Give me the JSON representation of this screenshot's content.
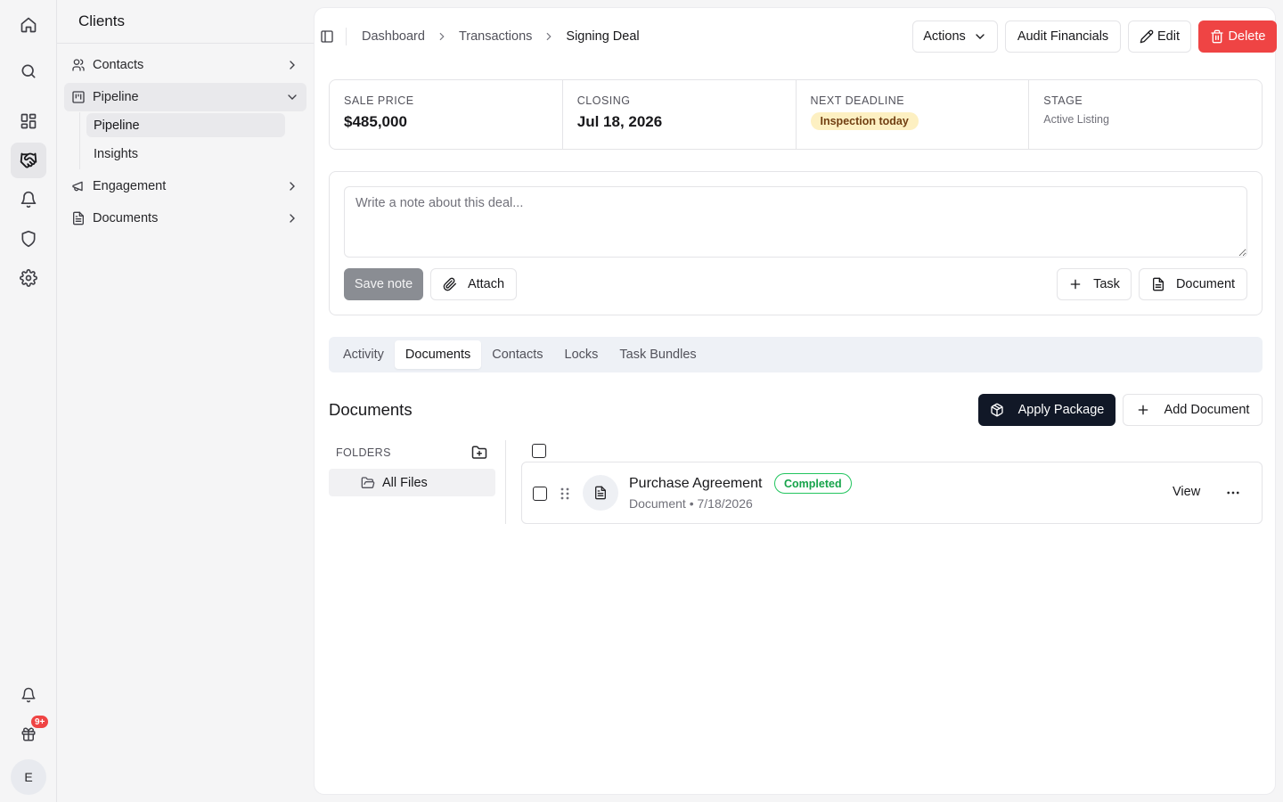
{
  "app": {
    "user_initial": "E",
    "gift_badge": "9+"
  },
  "sidebar": {
    "title": "Clients",
    "items": [
      {
        "label": "Contacts",
        "icon": "users-icon"
      },
      {
        "label": "Pipeline",
        "icon": "kanban-icon"
      },
      {
        "label": "Engagement",
        "icon": "megaphone-icon"
      },
      {
        "label": "Documents",
        "icon": "file-text-icon"
      }
    ],
    "pipeline_sub": [
      "Pipeline",
      "Insights"
    ]
  },
  "breadcrumb": [
    "Dashboard",
    "Transactions",
    "Signing Deal"
  ],
  "toolbar": {
    "actions_label": "Actions",
    "audit_label": "Audit Financials",
    "edit_label": "Edit",
    "delete_label": "Delete"
  },
  "stats": {
    "sale_price_label": "Sale Price",
    "sale_price": "$485,000",
    "closing_label": "Closing",
    "closing": "Jul 18, 2026",
    "deadline_label": "Next Deadline",
    "deadline": "Inspection today",
    "stage_label": "Stage",
    "stage": "Active Listing"
  },
  "composer": {
    "placeholder": "Write a note about this deal...",
    "value": "",
    "save_label": "Save note",
    "attach_label": "Attach",
    "task_label": "Task",
    "document_label": "Document"
  },
  "tabs": [
    "Activity",
    "Documents",
    "Contacts",
    "Locks",
    "Task Bundles"
  ],
  "documents": {
    "title": "Documents",
    "apply_label": "Apply Package",
    "add_label": "Add Document",
    "folders_label": "FOLDERS",
    "folder_all": "All Files",
    "items": [
      {
        "name": "Purchase Agreement",
        "status": "Completed",
        "meta": "Document • 7/18/2026",
        "view_label": "View"
      }
    ]
  },
  "colors": {
    "danger": "#ef4444",
    "dark_button": "#111827",
    "warning_pill_bg": "#fdf0c2",
    "success": "#16a34a"
  }
}
